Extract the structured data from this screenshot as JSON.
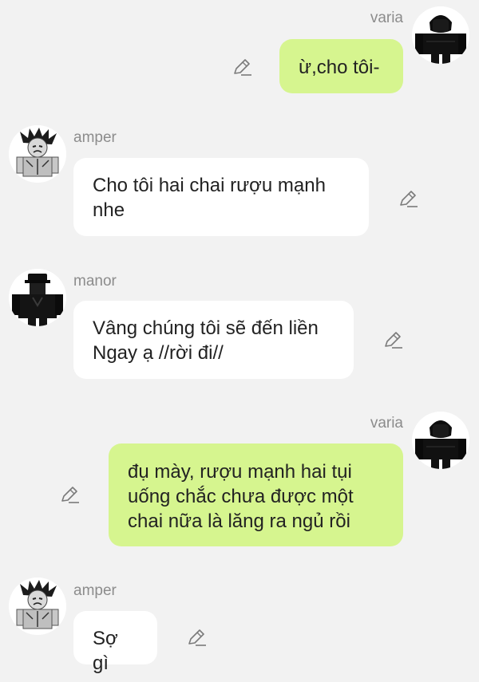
{
  "messages": [
    {
      "sender": "varia",
      "side": "right",
      "text": "ừ,cho tôi-",
      "avatar_icon": "dark-hooded-avatar-icon"
    },
    {
      "sender": "amper",
      "side": "left",
      "text": "Cho tôi hai chai rượu mạnh\nnhe",
      "avatar_icon": "spiky-hair-avatar-icon"
    },
    {
      "sender": "manor",
      "side": "left",
      "text": "Vâng chúng tôi sẽ đến liền\nNgay ạ //rời đi//",
      "avatar_icon": "dark-cap-avatar-icon"
    },
    {
      "sender": "varia",
      "side": "right",
      "text": "đụ mày, rượu mạnh hai tụi\nuống chắc chưa được một\nchai nữa là lăng ra ngủ rồi",
      "avatar_icon": "dark-hooded-avatar-icon"
    },
    {
      "sender": "amper",
      "side": "left",
      "text": "Sợ gì",
      "avatar_icon": "spiky-hair-avatar-icon"
    }
  ],
  "colors": {
    "background": "#f2f2f2",
    "left_bubble": "#ffffff",
    "right_bubble": "#d6f58f",
    "name_text": "#8c8c8c"
  },
  "icons": {
    "edit": "pencil-edit-icon"
  }
}
